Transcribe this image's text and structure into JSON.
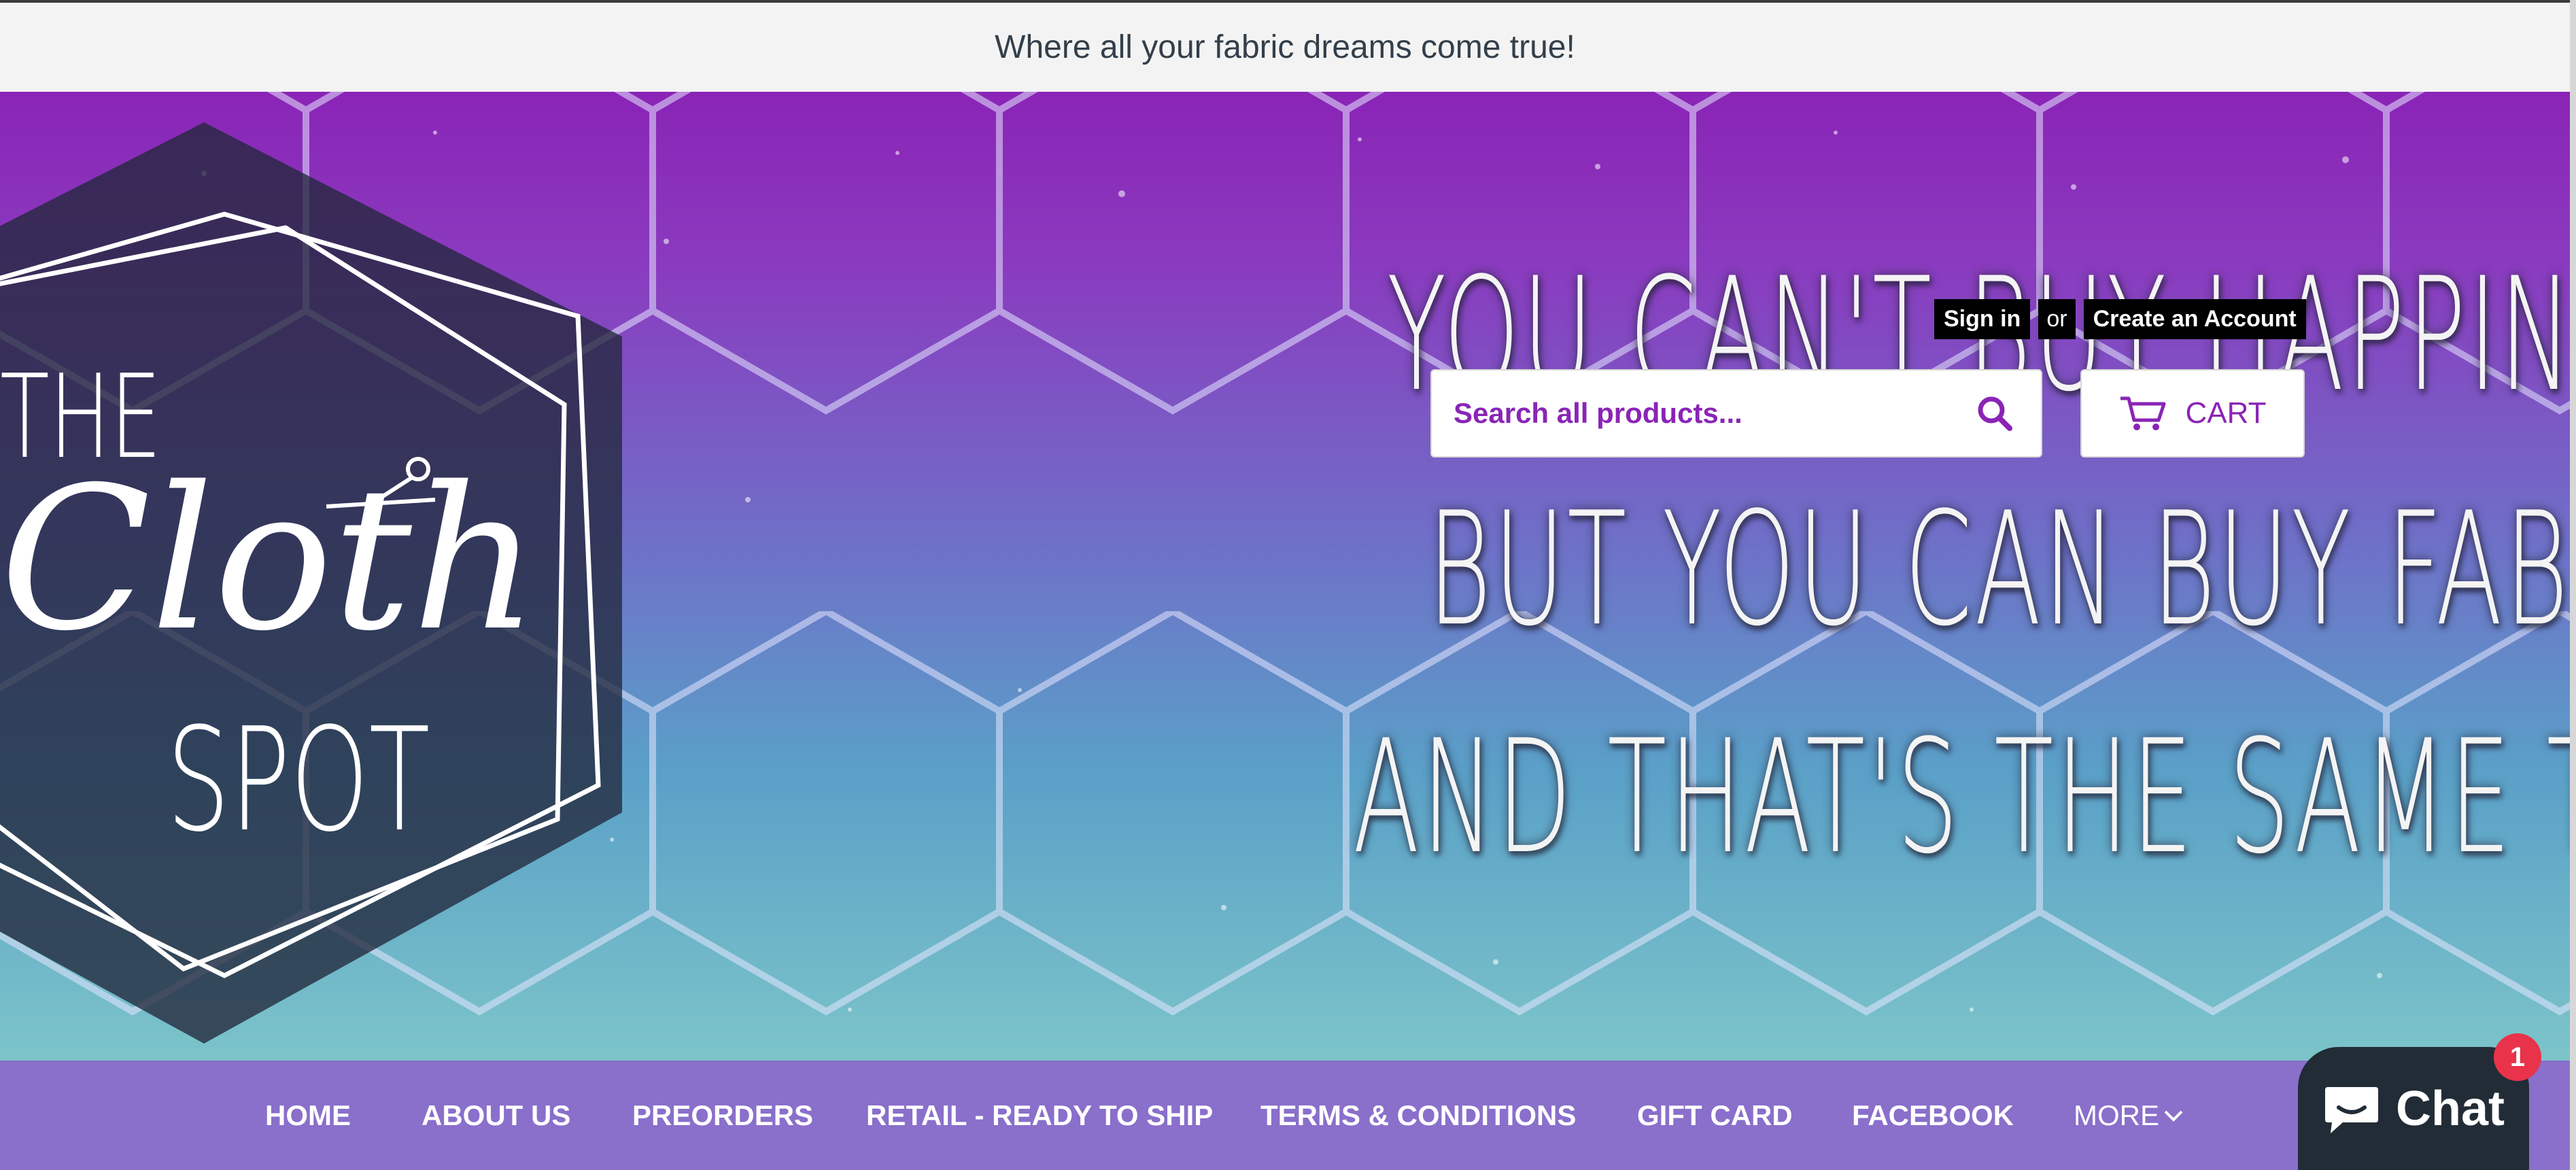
{
  "announcement": {
    "text": "Where all your fabric dreams come true!"
  },
  "brand": {
    "logo_text": {
      "the": "THE",
      "cloth": "Cloth",
      "spot": "SPOT"
    }
  },
  "hero": {
    "tagline": [
      "YOU CAN'T BUY HAPPINESS,",
      "BUT YOU CAN BUY FABRIC",
      "AND THAT'S THE SAME THING"
    ]
  },
  "account": {
    "sign_in": "Sign in",
    "or": "or",
    "create_account": "Create an Account"
  },
  "search": {
    "placeholder": "Search all products..."
  },
  "cart": {
    "label": "CART",
    "icon": "cart-icon"
  },
  "nav": {
    "items": [
      "HOME",
      "ABOUT US",
      "PREORDERS",
      "RETAIL - READY TO SHIP",
      "TERMS & CONDITIONS",
      "GIFT CARD",
      "FACEBOOK",
      "MORE"
    ]
  },
  "chat": {
    "label": "Chat",
    "badge": "1"
  },
  "colors": {
    "accent": "#8a24b6",
    "nav_bg": "#8a6fcb",
    "chat_bg": "#222c36",
    "badge": "#e8334a"
  }
}
